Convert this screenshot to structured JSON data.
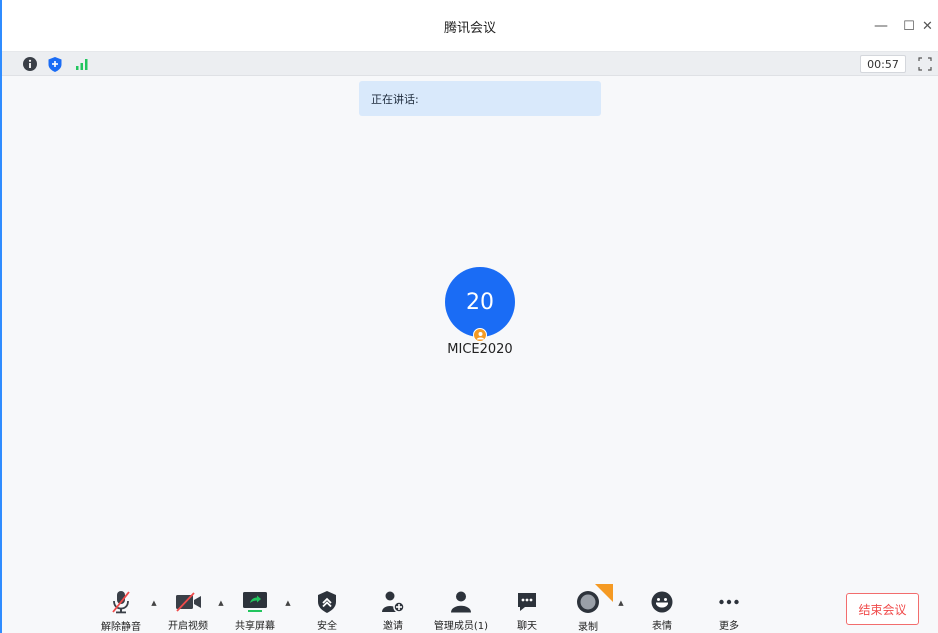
{
  "window": {
    "title": "腾讯会议",
    "minimize_glyph": "—",
    "maximize_glyph": "☐",
    "close_glyph": "✕"
  },
  "infobar": {
    "timer": "00:57",
    "icons": [
      "info-icon",
      "shield-icon",
      "signal-icon",
      "fullscreen-icon"
    ]
  },
  "speaking": {
    "label": "正在讲话:"
  },
  "participant": {
    "avatar_text": "20",
    "name": "MICE2020"
  },
  "toolbar": {
    "unmute": "解除静音",
    "start_video": "开启视频",
    "share_screen": "共享屏幕",
    "security": "安全",
    "invite": "邀请",
    "manage_members": "管理成员(1)",
    "chat": "聊天",
    "record": "录制",
    "reactions": "表情",
    "more": "更多",
    "end_meeting": "结束会议"
  },
  "colors": {
    "accent": "#1a6cf5",
    "end_meeting": "#f04a4a",
    "speaking_bg": "#d9e9fb",
    "host_badge": "#f59a23",
    "signal": "#22c55e"
  }
}
